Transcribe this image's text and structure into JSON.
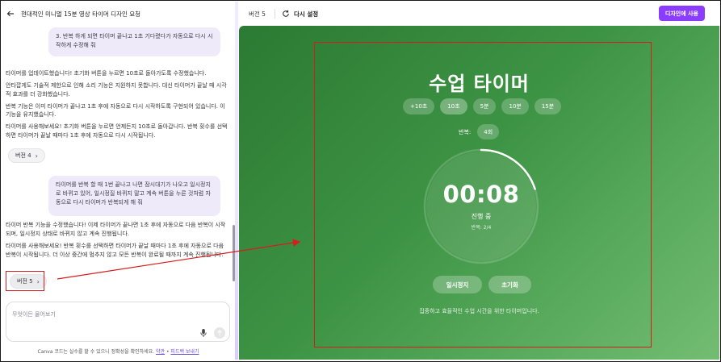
{
  "chat": {
    "title": "현대적인 미니멀 15분 영상 타이머 디자인 요청",
    "user_messages": [
      "3. 반복 하게 되면 타이머 끝나고 1초 기다렸다가 자동으로 다시 시작하게 수정해 줘",
      "타이머를 반복 할 때 1번 끝나고 나면 잠시대기가 나오고 일시정지로 바뀌고 있어, 일시정질 바뀌지 말고 계속 버튼을 누른 것처럼 자동으로 다시 타이머가 반복되게 해 줘"
    ],
    "ai_block_1": [
      "타이머를 업데이트했습니다! 초기화 버튼을 누르면 10초로 돌아가도록 수정했습니다.",
      "안타깝게도 기술적 제한으로 인해 소리 기능은 지원하지 못합니다. 대신 타이머가 끝날 때 시각적 효과를 더 강화했습니다.",
      "반복 기능은 이미 타이머가 끝나고 1초 후에 자동으로 다시 시작하도록 구현되어 있습니다. 이 기능을 유지했습니다.",
      "타이머를 사용해보세요! 초기화 버튼을 누르면 언제든지 10초로 돌아갑니다. 반복 횟수를 선택하면 타이머가 끝날 때마다 1초 후에 자동으로 다시 시작됩니다."
    ],
    "version_chip_1": "버전 4",
    "ai_block_2": [
      "타이머 반복 기능을 수정했습니다! 이제 타이머가 끝나면 1초 후에 자동으로 다음 반복이 시작되며, 일시정지 상태로 바뀌지 않고 계속 진행됩니다.",
      "타이머를 사용해보세요! 반복 횟수를 선택하면 타이머가 끝날 때마다 1초 후에 자동으로 다음 반복이 시작됩니다. 더 이상 중간에 멈추지 않고 모든 반복이 완료될 때까지 계속 진행됩니다."
    ],
    "version_chip_2": "버전 5",
    "input_placeholder": "무엇이든 물어보기",
    "disclaimer_text": "Canva 코드는 실수를 할 수 있으니 정확성을 확인하세요.",
    "disclaimer_link_1": "약관",
    "disclaimer_sep": " • ",
    "disclaimer_link_2": "피드백 보내기"
  },
  "topbar": {
    "version_label": "버전 5",
    "reset_label": "다시 설정",
    "use_design_label": "디자인에 사용"
  },
  "timer_app": {
    "title": "수업 타이머",
    "quick_buttons": [
      "+10초",
      "10초",
      "5분",
      "10분",
      "15분"
    ],
    "active_quick": "10초",
    "repeat_label": "반복:",
    "repeat_value": "4회",
    "time": "00:08",
    "status": "진행 중",
    "round": "반복: 2/4",
    "progress_fraction": 0.2,
    "pause_label": "일시정지",
    "reset_label": "초기화",
    "footer": "집중하고 효율적인 수업 시간을 위한 타이머입니다."
  },
  "colors": {
    "accent_purple": "#8b3dff",
    "annotation_red": "#d61d1d",
    "green_dark": "#2c7a33",
    "green_light": "#73bd72"
  }
}
